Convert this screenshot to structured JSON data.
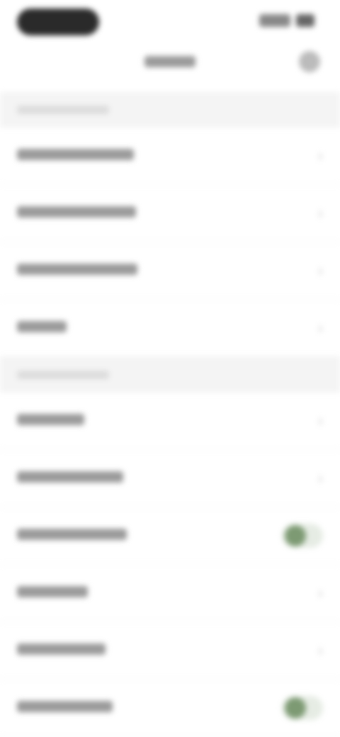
{
  "status_bar": {
    "time": "",
    "icons": [
      "signal-icon",
      "wifi-icon",
      "battery-icon"
    ]
  },
  "nav": {
    "title": "",
    "action_icon": "settings-icon"
  },
  "sections": [
    {
      "header": "",
      "rows": [
        {
          "label": "",
          "control": "chevron"
        },
        {
          "label": "",
          "control": "chevron"
        },
        {
          "label": "",
          "control": "chevron"
        },
        {
          "label": "",
          "control": "chevron"
        }
      ]
    },
    {
      "header": "",
      "rows": [
        {
          "label": "",
          "control": "chevron"
        },
        {
          "label": "",
          "control": "chevron"
        },
        {
          "label": "",
          "control": "toggle",
          "state": "on"
        },
        {
          "label": "",
          "control": "chevron"
        },
        {
          "label": "",
          "control": "chevron"
        },
        {
          "label": "",
          "control": "toggle",
          "state": "on"
        }
      ]
    }
  ],
  "colors": {
    "accent": "#7d9a73",
    "section_bg": "#f4f4f4",
    "background": "#ffffff"
  },
  "chevron_glyph": "›"
}
